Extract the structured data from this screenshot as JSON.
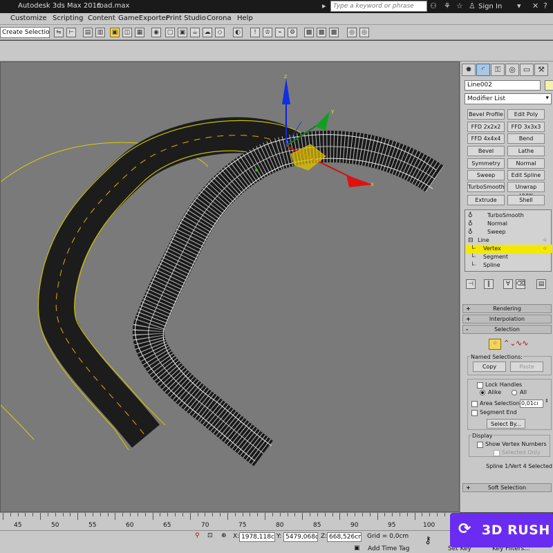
{
  "titlebar": {
    "app": "Autodesk 3ds Max 2016",
    "file": "road.max",
    "search_placeholder": "Type a keyword or phrase",
    "signin": "Sign In"
  },
  "menu": [
    "Customize",
    "Scripting",
    "Content",
    "GameExporter",
    "Print Studio",
    "Corona",
    "Help"
  ],
  "toolbar": {
    "selection_set": "Create Selection Se"
  },
  "command_panel": {
    "object_name": "Line002",
    "modifier_list": "Modifier List",
    "modifier_buttons": [
      "Bevel Profile",
      "Edit Poly",
      "FFD 2x2x2",
      "FFD 3x3x3",
      "FFD 4x4x4",
      "Bend",
      "Bevel",
      "Lathe",
      "Symmetry",
      "Normal",
      "Sweep",
      "Edit Spline",
      "TurboSmooth",
      "Unwrap UVW",
      "Extrude",
      "Shell"
    ],
    "stack": [
      "TurboSmooth",
      "Normal",
      "Sweep",
      "Line",
      "Vertex",
      "Segment",
      "Spline"
    ],
    "rollouts": {
      "rendering": "Rendering",
      "interpolation": "Interpolation",
      "selection": "Selection",
      "soft_selection": "Soft Selection"
    },
    "selection": {
      "named_selections": "Named Selections:",
      "copy": "Copy",
      "paste": "Paste",
      "lock_handles": "Lock Handles",
      "alike": "Alike",
      "all": "All",
      "area_selection": "Area Selection:",
      "area_value": "0,01cı",
      "segment_end": "Segment End",
      "select_by": "Select By...",
      "display": "Display",
      "show_vertex_numbers": "Show Vertex Numbers",
      "selected_only": "Selected Only",
      "status": "Spline 1/Vert 4 Selected"
    }
  },
  "timeline": {
    "ticks": [
      "45",
      "50",
      "55",
      "60",
      "65",
      "70",
      "75",
      "80",
      "85",
      "90",
      "95",
      "100"
    ]
  },
  "statusbar": {
    "x_label": "X:",
    "x_value": "1978,118c",
    "y_label": "Y:",
    "y_value": "5479,068c",
    "z_label": "Z:",
    "z_value": "668,526cm",
    "grid": "Grid = 0,0cm",
    "add_time_tag": "Add Time Tag",
    "set_key": "Set Key",
    "key_filters": "Key Filters..."
  },
  "watermark": "3D RUSH"
}
